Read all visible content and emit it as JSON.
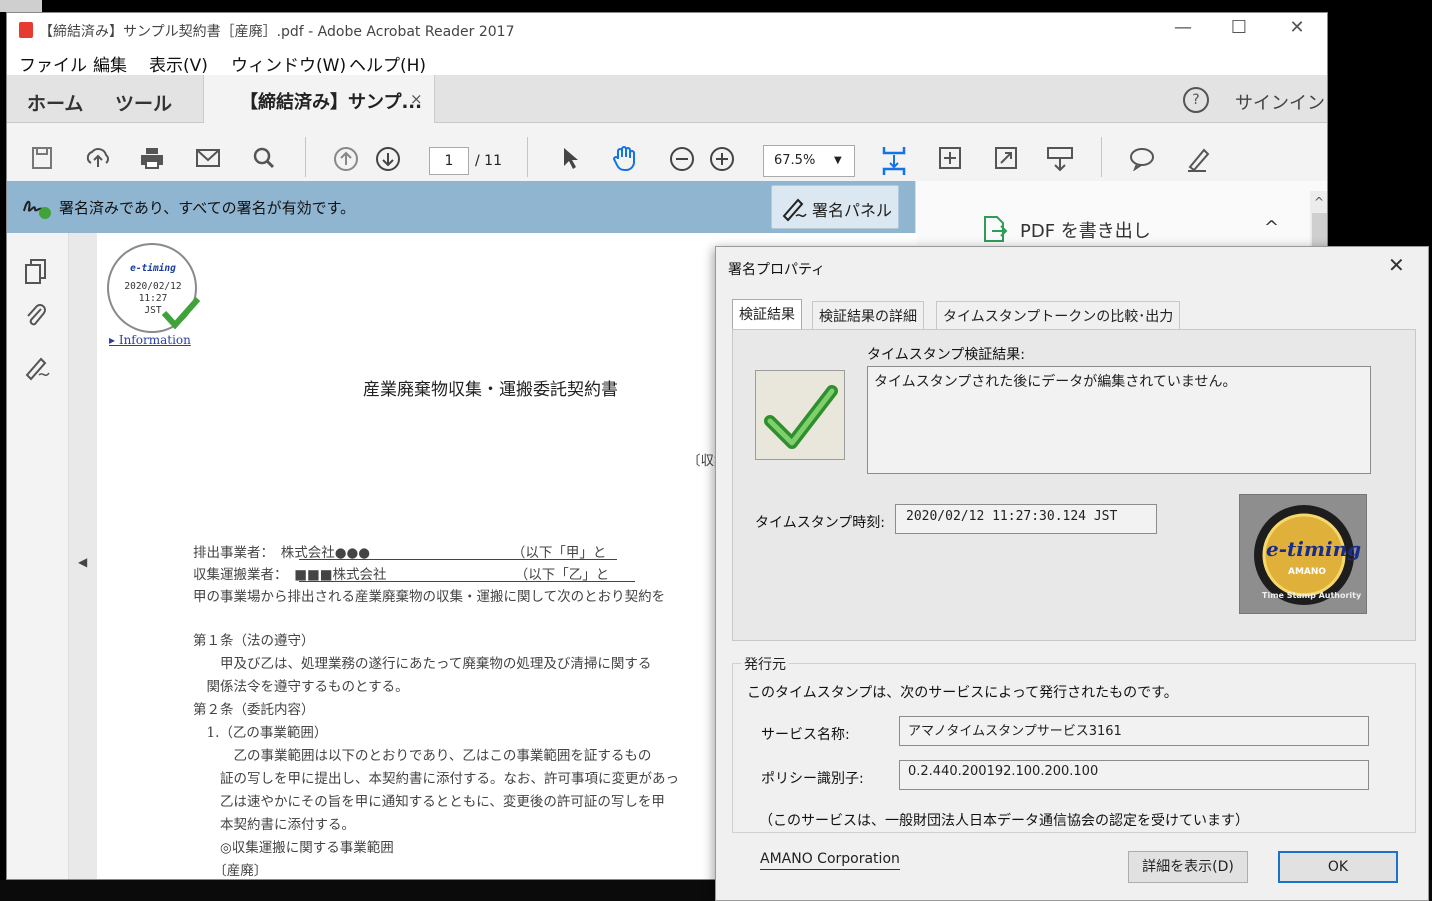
{
  "window": {
    "title": "【締結済み】サンプル契約書［産廃］.pdf - Adobe Acrobat Reader 2017",
    "minimize": "—",
    "maximize": "☐",
    "close": "✕"
  },
  "menu": [
    "ファイル",
    "編集",
    "表示(V)",
    "ウィンドウ(W)",
    "ヘルプ(H)"
  ],
  "tabs": {
    "home": "ホーム",
    "tools": "ツール",
    "doc_tab": "【締結済み】サンプ...",
    "doc_tab_close": "×",
    "help": "?",
    "signin": "サインイン"
  },
  "toolbar": {
    "page_current": "1",
    "page_total": "/ 11",
    "zoom": "67.5%",
    "zoom_arrow": "▼"
  },
  "signature_bar": {
    "status": "署名済みであり、すべての署名が有効です。",
    "panel_button": "署名パネル"
  },
  "right_pane": {
    "export_label": "PDF を書き出し",
    "collapse": "^"
  },
  "document": {
    "stamp_date": "2020/02/12",
    "stamp_time": "11:27",
    "stamp_tz": "JST",
    "info_link": "▸ Information",
    "title": "産業廃棄物収集・運搬委託契約書",
    "partial_right": "〔収集",
    "lines": [
      "排出事業者：　株式会社●●●　　　　　　　　　　　（以下「甲」と",
      "収集運搬業者：　■■■株式会社　　　　　　　　　　（以下「乙」と",
      "甲の事業場から排出される産業廃棄物の収集・運搬に関して次のとおり契約を",
      "第１条（法の遵守）",
      "　　甲及び乙は、処理業務の遂行にあたって廃棄物の処理及び清掃に関する",
      "　関係法令を遵守するものとする。",
      "第２条（委託内容）",
      "　1.（乙の事業範囲）",
      "　　　乙の事業範囲は以下のとおりであり、乙はこの事業範囲を証するもの",
      "　　証の写しを甲に提出し、本契約書に添付する。なお、許可事項に変更があっ",
      "　　乙は速やかにその旨を甲に通知するとともに、変更後の許可証の写しを甲",
      "　　本契約書に添付する。",
      "　　◎収集運搬に関する事業範囲",
      "　　〔産廃〕"
    ]
  },
  "dialog": {
    "title": "署名プロパティ",
    "close": "✕",
    "tabs": [
      "検証結果",
      "検証結果の詳細",
      "タイムスタンプトークンの比較･出力"
    ],
    "result_label": "タイムスタンプ検証結果:",
    "result_text": "タイムスタンプされた後にデータが編集されていません。",
    "time_label": "タイムスタンプ時刻:",
    "time_value": "2020/02/12 11:27:30.124 JST",
    "logo_brand": "e-timing",
    "logo_sub": "AMANO",
    "logo_ring": "Time Stamp Authority",
    "issuer_group": "発行元",
    "issuer_text": "このタイムスタンプは、次のサービスによって発行されたものです。",
    "service_label": "サービス名称:",
    "service_value": "アマノタイムスタンプサービス3161",
    "policy_label": "ポリシー識別子:",
    "policy_value": "0.2.440.200192.100.200.100",
    "cert_note": "（このサービスは、一般財団法人日本データ通信協会の認定を受けています）",
    "company_link": "AMANO Corporation",
    "details_button": "詳細を表示(D)",
    "ok_button": "OK"
  },
  "colors": {
    "sig_bar": "#8fb5d0",
    "ok_border": "#1a73c9",
    "check_green": "#3fa33a",
    "pdf_red": "#e63b2e"
  }
}
